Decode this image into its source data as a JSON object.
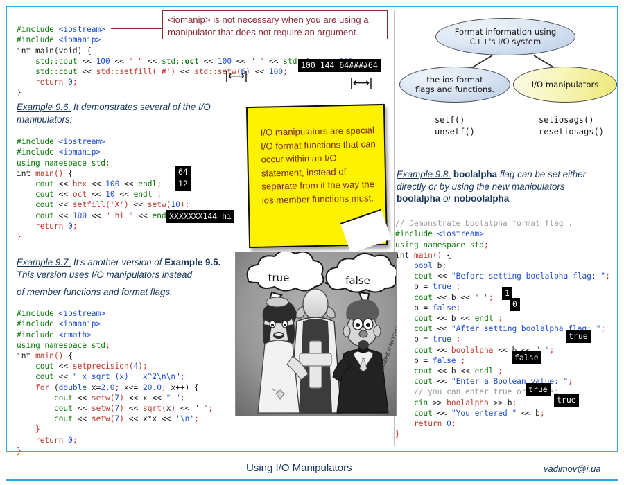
{
  "frame": {
    "border_color": "#2FA8DF"
  },
  "callout": {
    "text": "<iomanip> is not necessary when you are using a manipulator that does not require an argument.",
    "color": "#8C2B38"
  },
  "example_top": {
    "code_lines": [
      "#include <iostream>",
      "#include <iomanip>",
      "int main(void) {",
      "    std::cout << 100 << \" \" << std::oct << 100 << \" \" << std::hex << 100;",
      "    std::cout << std::setfill('#') << std::setw(6) << 100;",
      "    return 0;",
      "}"
    ],
    "output": "100 144 64####64",
    "bracket_glyph": "|⟷|"
  },
  "diagram": {
    "root": "Format information using\nC++'s I/O system",
    "left_node": "the ios format\nflags and functions.",
    "right_node": "I/O manipulators",
    "left_functions": "setf()\nunsetf()",
    "right_functions": "setiosags()\nresetiosags()"
  },
  "example_96": {
    "heading_label": "Example 9.6.",
    "heading_rest": " It demonstrates several of the I/O",
    "heading_line2": "manipulators:",
    "code_lines": [
      "#include <iostream>",
      "#include <iomanip>",
      "using namespace std;",
      "int main() {",
      "    cout << hex << 100 << endl;",
      "    cout << oct << 10 << endl ;",
      "    cout << setfill('X') << setw(10);",
      "    cout << 100 << \" hi \" << endl;",
      "    return 0;",
      "}"
    ],
    "out1": "64",
    "out2": "12",
    "out3": "XXXXXXX144 hi"
  },
  "sticky": {
    "text": "I/O manipulators are special I/O format functions that can occur within an I/O statement, instead of separate from it the way the ios member functions must.",
    "bg": "#FFF200",
    "fg": "#7B2D12"
  },
  "example_97": {
    "heading_label": "Example 9.7.",
    "heading_rest": " It's another version of ",
    "heading_bold": "Example 9.5.",
    "heading_line2": "This version uses I/O manipulators instead",
    "heading_line3": "of member functions and format flags.",
    "code_lines": [
      "#include <iostream>",
      "#include <iomanip>",
      "#include <cmath>",
      "using namespace std;",
      "int main() {",
      "    cout << setprecision(4);",
      "    cout << \" x sqrt (x)   x^2\\n\\n\";",
      "    for (double x=2.0; x<= 20.0; x++) {",
      "        cout << setw(7) << x << \" \";",
      "        cout << setw(7) << sqrt(x) << \" \";",
      "        cout << setw(7) << x*x << '\\n';",
      "    }",
      "    return 0;",
      "}"
    ]
  },
  "example_98": {
    "heading_label": "Example 9.8.",
    "heading_bold1": "boolalpha",
    "heading_rest1": " flag can be set either",
    "heading_line2": "directly or by using the new manipulators",
    "heading_bold2": "boolalpha",
    "heading_mid": " or ",
    "heading_bold3": "noboolalpha",
    "heading_end": ".",
    "code_lines": [
      "// Demonstrate boolalpha format flag .",
      "#include <iostream>",
      "using namespace std;",
      "int main() {",
      "    bool b;",
      "    cout << \"Before setting boolalpha flag: \";",
      "    b = true ;",
      "    cout << b << \" \";",
      "    b = false;",
      "    cout << b << endl ;",
      "    cout << \"After setting boolalpha flag: \";",
      "    b = true ;",
      "    cout << boolalpha << b << \" \";",
      "    b = false ;",
      "    cout << b << endl ;",
      "    cout << \"Enter a Boolean value: \";",
      "    // you can enter true or false:",
      "    cin >> boolalpha >> b;",
      "    cout << \"You entered \" << b;",
      "    return 0;",
      "}"
    ],
    "outputs": [
      "1",
      "0",
      "true",
      "false",
      "true",
      "true"
    ]
  },
  "cartoon": {
    "bubble_left": "true",
    "bubble_right": "false",
    "signature": "ANDREW MATTHEWS"
  },
  "footer": {
    "title": "Using I/O Manipulators",
    "email": "vadimov@i.ua"
  }
}
